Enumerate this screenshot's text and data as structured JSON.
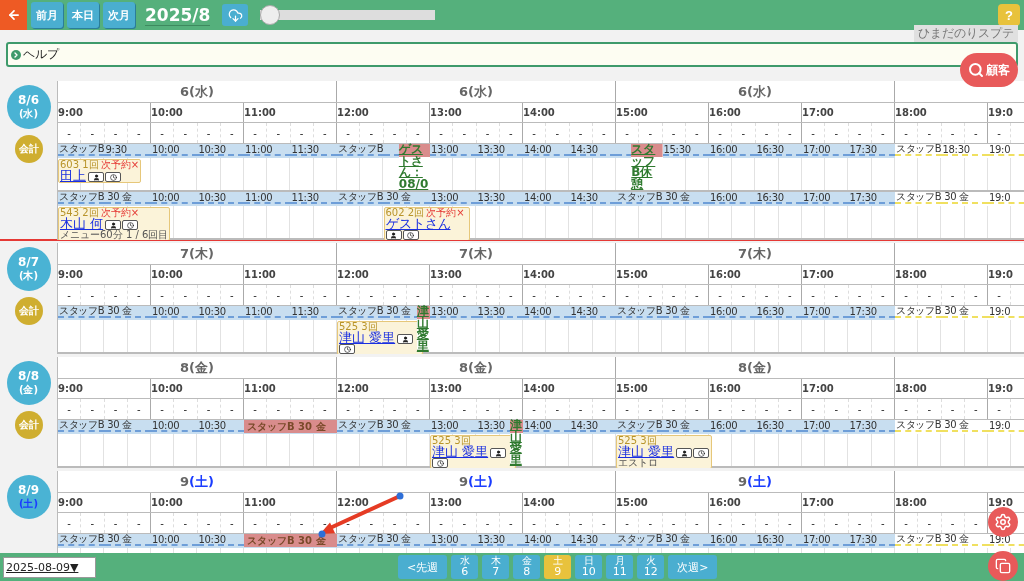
{
  "toolbar": {
    "buttons": [
      "前月",
      "本日",
      "次月"
    ],
    "title": "2025/8",
    "slider": {
      "level": 0.0
    },
    "help": "?",
    "hint": "ひまだのりスプテ"
  },
  "help_bar": {
    "label": "ヘルプ"
  },
  "customer_button": "顧客",
  "days": [
    {
      "badge_date": "8/6",
      "badge_weekday": "(水)",
      "weekend": false,
      "current": false,
      "checkout": "会計",
      "headers": [
        {
          "day": "6",
          "weekday": "(水)"
        },
        {
          "day": "6",
          "weekday": "(水)"
        },
        {
          "day": "6",
          "weekday": "(水)"
        }
      ],
      "hours": [
        "9:00",
        "10:00",
        "11:00",
        "12:00",
        "13:00",
        "14:00",
        "15:00",
        "16:00",
        "17:00",
        "18:00",
        "19:0"
      ],
      "dashes": [
        "-",
        "-",
        "-",
        "-",
        "-",
        "-",
        "-",
        "-",
        "-",
        "-",
        "-",
        "-",
        "-",
        "-",
        "-",
        "-",
        "-",
        "-",
        "-",
        "-",
        "-",
        "-",
        "-",
        "-",
        "-",
        "-",
        "-",
        "-",
        "-",
        "-",
        "-",
        "-",
        "-",
        "-",
        "-",
        "-",
        "-",
        "-",
        "-",
        "-",
        "-"
      ],
      "staff_rows": [
        {
          "slots": [
            {
              "kind": "label",
              "label": "スタッフB",
              "entries": [
                {
                  "kind": "card",
                  "number": "603 1回",
                  "next": "次予約×",
                  "name": "田上"
                }
              ]
            },
            {
              "kind": "label",
              "label": "9:30"
            },
            {
              "kind": "label",
              "label": "10:00"
            },
            {
              "kind": "label",
              "label": "10:30"
            },
            {
              "kind": "label",
              "label": "11:00"
            },
            {
              "kind": "label",
              "label": "11:30"
            },
            {
              "kind": "label",
              "label": "スタッフB"
            },
            {
              "kind": "blank",
              "entries": [
                {
                  "kind": "vertical",
                  "text": "ゲストさん：08/0"
                }
              ]
            },
            {
              "kind": "label",
              "label": "13:00"
            },
            {
              "kind": "label",
              "label": "13:30"
            },
            {
              "kind": "label",
              "label": "14:00"
            },
            {
              "kind": "label",
              "label": "14:30"
            },
            {
              "kind": "blank",
              "entries": [
                {
                  "kind": "vertical",
                  "text": "スタッフB休憩"
                }
              ]
            },
            {
              "kind": "label",
              "label": "15:30"
            },
            {
              "kind": "label",
              "label": "16:00"
            },
            {
              "kind": "label",
              "label": "16:30"
            },
            {
              "kind": "label",
              "label": "17:00"
            },
            {
              "kind": "label",
              "label": "17:30"
            },
            {
              "kind": "label",
              "label": "スタッフB"
            },
            {
              "kind": "label",
              "label": "18:30"
            },
            {
              "kind": "label",
              "label": "19:0"
            }
          ]
        },
        {
          "slots": [
            {
              "kind": "label",
              "label": "スタッフB 30 金",
              "entries": [
                {
                  "kind": "card",
                  "number": "543 2回",
                  "next": "次予約×",
                  "name": "木山 何",
                  "memo": "メニュー60分 1 / 6回目"
                }
              ]
            },
            {
              "kind": "blank"
            },
            {
              "kind": "label",
              "label": "10:00"
            },
            {
              "kind": "label",
              "label": "10:30"
            },
            {
              "kind": "label",
              "label": "11:00"
            },
            {
              "kind": "label",
              "label": "11:30"
            },
            {
              "kind": "label",
              "label": "スタッフB 30 金"
            },
            {
              "kind": "blank",
              "entries": [
                {
                  "kind": "card",
                  "number": "602 2回",
                  "next": "次予約×",
                  "name": "ゲストさん"
                }
              ]
            },
            {
              "kind": "label",
              "label": "13:00"
            },
            {
              "kind": "label",
              "label": "13:30"
            },
            {
              "kind": "label",
              "label": "14:00"
            },
            {
              "kind": "label",
              "label": "14:30"
            },
            {
              "kind": "label",
              "label": "スタッフB 30 金"
            },
            {
              "kind": "blank"
            },
            {
              "kind": "label",
              "label": "16:00"
            },
            {
              "kind": "label",
              "label": "16:30"
            },
            {
              "kind": "label",
              "label": "17:00"
            },
            {
              "kind": "label",
              "label": "17:30"
            },
            {
              "kind": "label",
              "label": "スタッフB 30 金"
            },
            {
              "kind": "blank"
            },
            {
              "kind": "label",
              "label": "19:0"
            }
          ]
        }
      ]
    },
    {
      "badge_date": "8/7",
      "badge_weekday": "(木)",
      "weekend": false,
      "current": true,
      "checkout": "会計",
      "headers": [
        {
          "day": "7",
          "weekday": "(木)"
        },
        {
          "day": "7",
          "weekday": "(木)"
        },
        {
          "day": "7",
          "weekday": "(木)"
        }
      ],
      "hours": [
        "9:00",
        "10:00",
        "11:00",
        "12:00",
        "13:00",
        "14:00",
        "15:00",
        "16:00",
        "17:00",
        "18:00",
        "19:0"
      ],
      "dashes": [
        "-",
        "-",
        "-",
        "-",
        "-",
        "-",
        "-",
        "-",
        "-",
        "-",
        "-",
        "-",
        "-",
        "-",
        "-",
        "-",
        "-",
        "-",
        "-",
        "-",
        "-",
        "-",
        "-",
        "-",
        "-",
        "-",
        "-",
        "-",
        "-",
        "-",
        "-",
        "-",
        "-",
        "-",
        "-",
        "-",
        "-",
        "-",
        "-",
        "-",
        "-"
      ],
      "staff_rows": [
        {
          "slots": [
            {
              "kind": "label",
              "label": "スタッフB 30 金"
            },
            {
              "kind": "blank"
            },
            {
              "kind": "label",
              "label": "10:00"
            },
            {
              "kind": "label",
              "label": "10:30"
            },
            {
              "kind": "label",
              "label": "11:00"
            },
            {
              "kind": "label",
              "label": "11:30"
            },
            {
              "kind": "label",
              "label": "スタッフB 30 金",
              "entries": [
                {
                  "kind": "card",
                  "number": "525 3回",
                  "name": "津山 愛里"
                }
              ]
            },
            {
              "kind": "blank",
              "entries": [
                {
                  "kind": "vertical",
                  "text": "津山愛里"
                }
              ]
            },
            {
              "kind": "label",
              "label": "13:00"
            },
            {
              "kind": "label",
              "label": "13:30"
            },
            {
              "kind": "label",
              "label": "14:00"
            },
            {
              "kind": "label",
              "label": "14:30"
            },
            {
              "kind": "label",
              "label": "スタッフB 30 金"
            },
            {
              "kind": "blank"
            },
            {
              "kind": "label",
              "label": "16:00"
            },
            {
              "kind": "label",
              "label": "16:30"
            },
            {
              "kind": "label",
              "label": "17:00"
            },
            {
              "kind": "label",
              "label": "17:30"
            },
            {
              "kind": "label",
              "label": "スタッフB 30 金"
            },
            {
              "kind": "blank"
            },
            {
              "kind": "label",
              "label": "19:0"
            }
          ]
        }
      ]
    },
    {
      "badge_date": "8/8",
      "badge_weekday": "(金)",
      "weekend": false,
      "current": false,
      "checkout": "会計",
      "headers": [
        {
          "day": "8",
          "weekday": "(金)"
        },
        {
          "day": "8",
          "weekday": "(金)"
        },
        {
          "day": "8",
          "weekday": "(金)"
        }
      ],
      "hours": [
        "9:00",
        "10:00",
        "11:00",
        "12:00",
        "13:00",
        "14:00",
        "15:00",
        "16:00",
        "17:00",
        "18:00",
        "19:0"
      ],
      "dashes": [
        "-",
        "-",
        "-",
        "-",
        "-",
        "-",
        "-",
        "-",
        "-",
        "-",
        "-",
        "-",
        "-",
        "-",
        "-",
        "-",
        "-",
        "-",
        "-",
        "-",
        "-",
        "-",
        "-",
        "-",
        "-",
        "-",
        "-",
        "-",
        "-",
        "-",
        "-",
        "-",
        "-",
        "-",
        "-",
        "-",
        "-",
        "-",
        "-",
        "-",
        "-"
      ],
      "staff_rows": [
        {
          "slots": [
            {
              "kind": "label",
              "label": "スタッフB 30 金"
            },
            {
              "kind": "blank"
            },
            {
              "kind": "label",
              "label": "10:00"
            },
            {
              "kind": "label",
              "label": "10:30"
            },
            {
              "kind": "blank",
              "entries": [
                {
                  "kind": "block",
                  "text": "スタッフB 30 金"
                }
              ]
            },
            {
              "kind": "blank"
            },
            {
              "kind": "label",
              "label": "スタッフB 30 金"
            },
            {
              "kind": "blank"
            },
            {
              "kind": "label",
              "label": "13:00",
              "entries": [
                {
                  "kind": "card",
                  "number": "525 3回",
                  "name": "津山 愛里"
                }
              ]
            },
            {
              "kind": "label",
              "label": "13:30",
              "entries": [
                {
                  "kind": "vertical",
                  "text": "津山愛里"
                }
              ]
            },
            {
              "kind": "label",
              "label": "14:00"
            },
            {
              "kind": "label",
              "label": "14:30"
            },
            {
              "kind": "label",
              "label": "スタッフB 30 金",
              "entries": [
                {
                  "kind": "card",
                  "number": "525 3回",
                  "name": "津山 愛里",
                  "memo": "エストロ"
                }
              ]
            },
            {
              "kind": "blank"
            },
            {
              "kind": "label",
              "label": "16:00"
            },
            {
              "kind": "label",
              "label": "16:30"
            },
            {
              "kind": "label",
              "label": "17:00"
            },
            {
              "kind": "label",
              "label": "17:30"
            },
            {
              "kind": "label",
              "label": "スタッフB 30 金"
            },
            {
              "kind": "blank"
            },
            {
              "kind": "label",
              "label": "19:0"
            }
          ]
        }
      ]
    },
    {
      "badge_date": "8/9",
      "badge_weekday": "(土)",
      "weekend": true,
      "current": false,
      "headers": [
        {
          "day": "9",
          "weekday": "(土)"
        },
        {
          "day": "9",
          "weekday": "(土)"
        },
        {
          "day": "9",
          "weekday": "(土)"
        }
      ],
      "hours": [
        "9:00",
        "10:00",
        "11:00",
        "12:00",
        "13:00",
        "14:00",
        "15:00",
        "16:00",
        "17:00",
        "18:00",
        "19:0"
      ],
      "dashes": [
        "-",
        "-",
        "-",
        "-",
        "-",
        "-",
        "-",
        "-",
        "-",
        "-",
        "-",
        "-",
        "-",
        "-",
        "-",
        "-",
        "-",
        "-",
        "-",
        "-",
        "-",
        "-",
        "-",
        "-",
        "-",
        "-",
        "-",
        "-",
        "-",
        "-",
        "-",
        "-",
        "-",
        "-",
        "-",
        "-",
        "-",
        "-",
        "-",
        "-"
      ],
      "staff_rows": [
        {
          "slots": [
            {
              "kind": "label",
              "label": "スタッフB 30 金"
            },
            {
              "kind": "blank"
            },
            {
              "kind": "label",
              "label": "10:00"
            },
            {
              "kind": "label",
              "label": "10:30"
            },
            {
              "kind": "blank",
              "entries": [
                {
                  "kind": "block",
                  "text": "スタッフB 30 金"
                }
              ]
            },
            {
              "kind": "blank"
            },
            {
              "kind": "label",
              "label": "スタッフB 30 金"
            },
            {
              "kind": "blank"
            },
            {
              "kind": "label",
              "label": "13:00"
            },
            {
              "kind": "label",
              "label": "13:30"
            },
            {
              "kind": "label",
              "label": "14:00"
            },
            {
              "kind": "label",
              "label": "14:30"
            },
            {
              "kind": "label",
              "label": "スタッフB 30 金"
            },
            {
              "kind": "blank"
            },
            {
              "kind": "label",
              "label": "16:00"
            },
            {
              "kind": "label",
              "label": "16:30"
            },
            {
              "kind": "label",
              "label": "17:00"
            },
            {
              "kind": "label",
              "label": "17:30"
            },
            {
              "kind": "label",
              "label": "スタッフB 30 金"
            },
            {
              "kind": "blank"
            },
            {
              "kind": "label",
              "label": "19:0"
            }
          ]
        }
      ]
    }
  ],
  "bottom_bar": {
    "date_select": "2025-08-09▼",
    "prev": "<先週",
    "next": "次週>",
    "days": [
      {
        "weekday": "水",
        "day": "6",
        "selected": false
      },
      {
        "weekday": "木",
        "day": "7",
        "selected": false
      },
      {
        "weekday": "金",
        "day": "8",
        "selected": false
      },
      {
        "weekday": "土",
        "day": "9",
        "selected": true
      },
      {
        "weekday": "日",
        "day": "10",
        "selected": false
      },
      {
        "weekday": "月",
        "day": "11",
        "selected": false
      },
      {
        "weekday": "火",
        "day": "12",
        "selected": false
      }
    ]
  }
}
